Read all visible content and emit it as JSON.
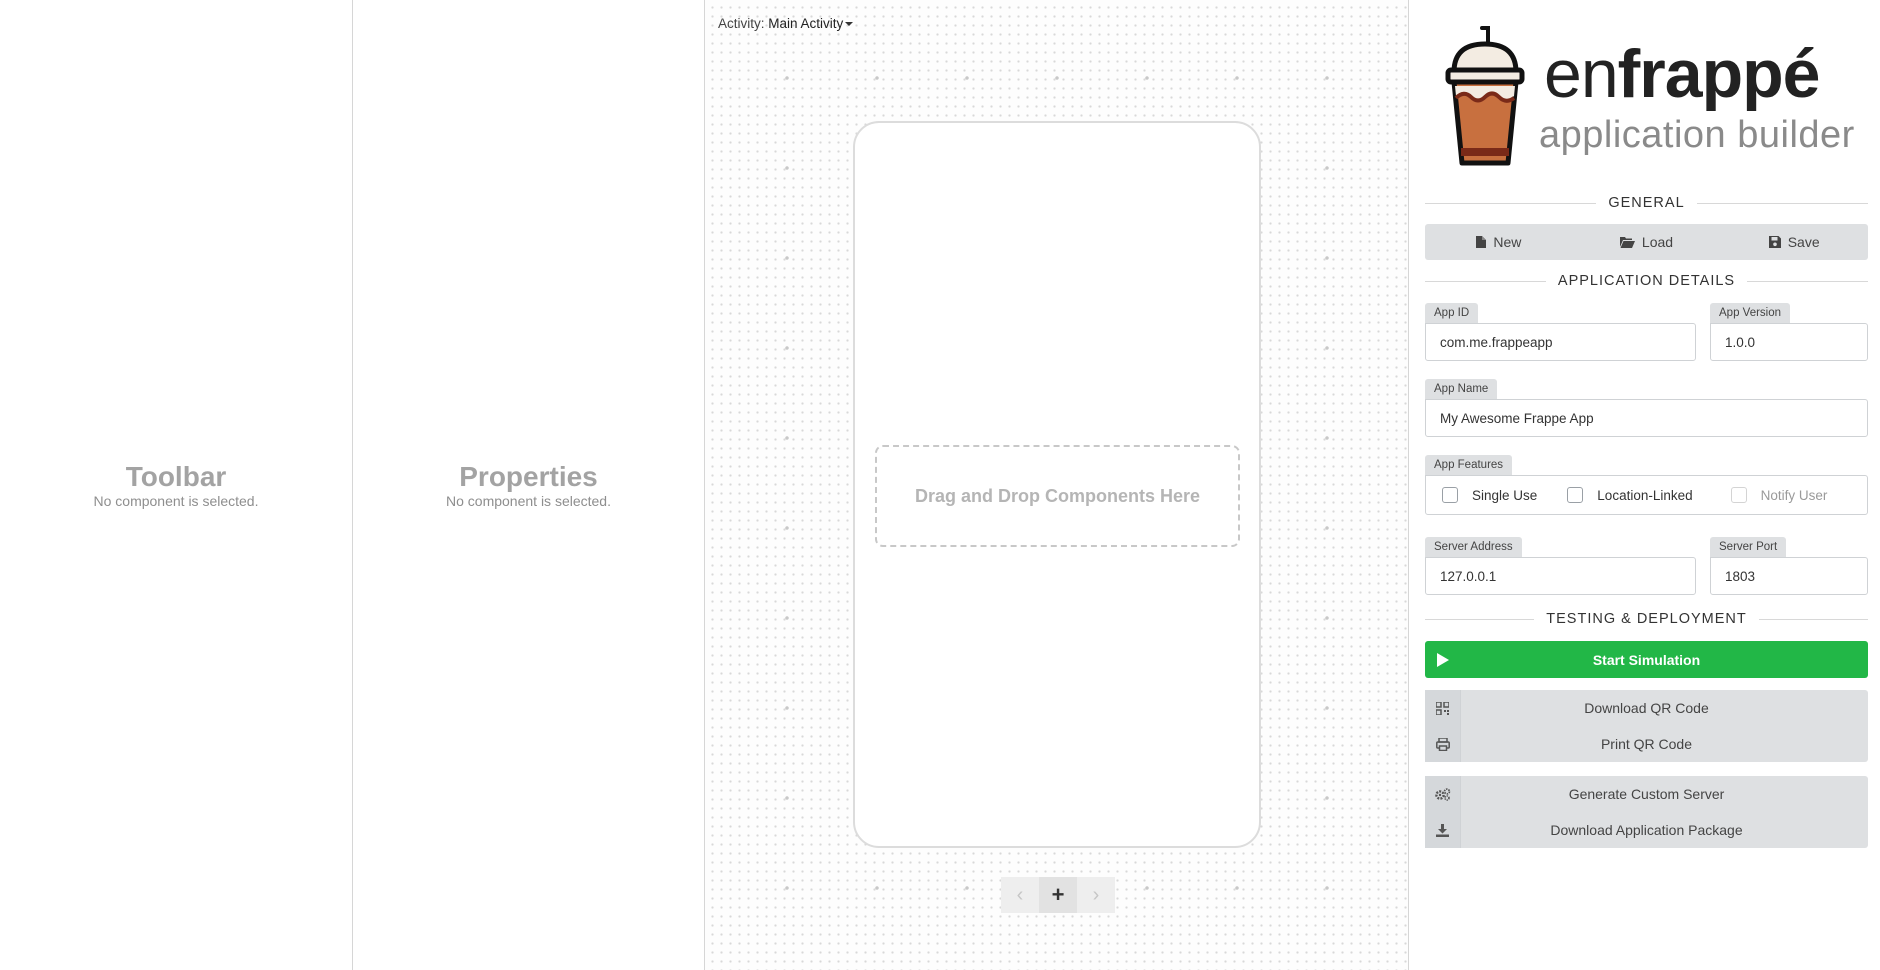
{
  "toolbar_panel": {
    "title": "Toolbar",
    "subtitle": "No component is selected."
  },
  "properties_panel": {
    "title": "Properties",
    "subtitle": "No component is selected."
  },
  "canvas": {
    "activity_label": "Activity:",
    "activity_value": "Main Activity",
    "drop_hint": "Drag and Drop Components Here",
    "pager": {
      "prev": "‹",
      "add": "+",
      "next": "›"
    }
  },
  "brand": {
    "name_light": "en",
    "name_bold": "frappé",
    "tagline": "application builder"
  },
  "general": {
    "heading": "GENERAL",
    "new_label": "New",
    "load_label": "Load",
    "save_label": "Save"
  },
  "details": {
    "heading": "APPLICATION DETAILS",
    "app_id": {
      "label": "App ID",
      "value": "com.me.frappeapp"
    },
    "app_version": {
      "label": "App Version",
      "value": "1.0.0"
    },
    "app_name": {
      "label": "App Name",
      "value": "My Awesome Frappe App"
    },
    "features": {
      "label": "App Features",
      "options": [
        {
          "label": "Single Use",
          "checked": false,
          "disabled": false
        },
        {
          "label": "Location-Linked",
          "checked": false,
          "disabled": false
        },
        {
          "label": "Notify User",
          "checked": false,
          "disabled": true
        }
      ]
    },
    "server_address": {
      "label": "Server Address",
      "value": "127.0.0.1"
    },
    "server_port": {
      "label": "Server Port",
      "value": "1803"
    }
  },
  "deploy": {
    "heading": "TESTING & DEPLOYMENT",
    "start_label": "Start Simulation",
    "download_qr_label": "Download QR Code",
    "print_qr_label": "Print QR Code",
    "generate_server_label": "Generate Custom Server",
    "download_package_label": "Download Application Package"
  },
  "colors": {
    "accent_green": "#22b747",
    "panel_gray": "#dee0e2"
  }
}
